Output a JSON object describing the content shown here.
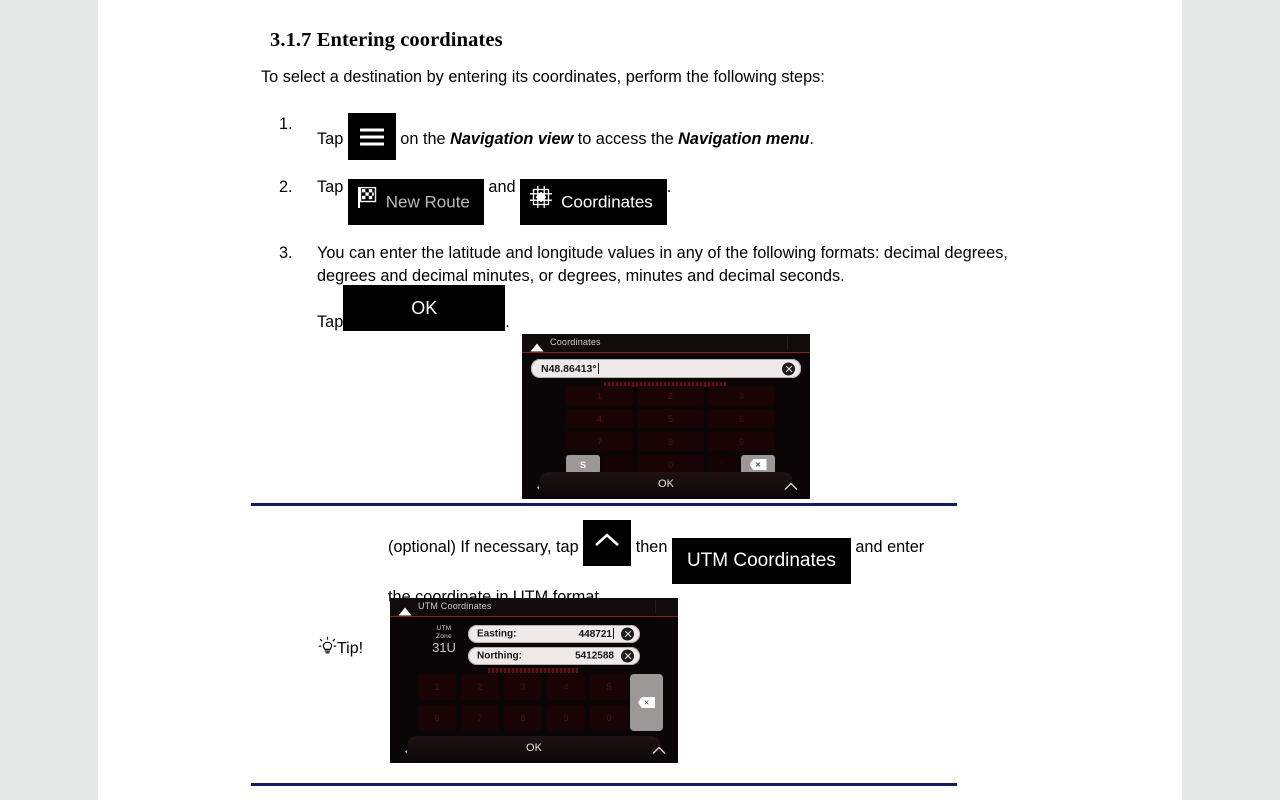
{
  "document": {
    "section_number": "3.1.7",
    "section_title": "3.1.7 Entering coordinates",
    "intro": "To select a destination by entering its coordinates, perform the following steps:"
  },
  "steps": [
    {
      "number": "1.",
      "text_before": "Tap",
      "chip": {
        "icon": "hamburger-icon",
        "label": ""
      },
      "text_mid": " on the ",
      "emphasis_1": "Navigation view",
      "text_mid_2": " to access the ",
      "emphasis_2": "Navigation menu",
      "text_after": "."
    },
    {
      "number": "2.",
      "text_before": "Tap",
      "chip_1": {
        "icon": "checkered-flag-icon",
        "label": "New Route"
      },
      "text_mid": "and",
      "chip_2": {
        "icon": "coordinates-grid-icon",
        "label": "Coordinates"
      },
      "text_after": "."
    },
    {
      "number": "3.",
      "text": "You can enter the latitude and longitude values in any of the following formats: decimal degrees, degrees and decimal minutes, or degrees, minutes and decimal seconds.",
      "tap_label": "Tap",
      "chip": {
        "label": "OK"
      },
      "text_after": "."
    }
  ],
  "screens": {
    "coordinates": {
      "title": "Coordinates",
      "header_icon": "up-triangle-icon",
      "input_value": "N48.86413°",
      "clear_icon": "clear-circle-icon",
      "keypad_rows": [
        [
          "1",
          "2",
          "3"
        ],
        [
          "4",
          "5",
          "6"
        ],
        [
          "7",
          "8",
          "9"
        ]
      ],
      "bottom_keys": [
        "S",
        "'",
        "0",
        "\""
      ],
      "backspace_icon": "backspace-icon",
      "footer": {
        "back_icon": "arrow-left-icon",
        "ok_label": "OK",
        "expand_icon": "chevron-up-icon"
      }
    },
    "utm_coordinates": {
      "title": "UTM Coordinates",
      "header_icon": "up-triangle-icon",
      "zone_label_line1": "UTM",
      "zone_label_line2": "Zone",
      "zone_value": "31U",
      "fields": [
        {
          "label": "Easting:",
          "value": "448721"
        },
        {
          "label": "Northing:",
          "value": "5412588"
        }
      ],
      "clear_icon": "clear-circle-icon",
      "keypad_rows": [
        [
          "1",
          "2",
          "3",
          "4",
          "5"
        ],
        [
          "6",
          "7",
          "8",
          "9",
          "0"
        ]
      ],
      "backspace_icon": "backspace-icon",
      "footer": {
        "back_icon": "arrow-left-icon",
        "ok_label": "OK",
        "expand_icon": "chevron-up-icon"
      }
    }
  },
  "optional_note": {
    "text_before": "(optional) If necessary, tap",
    "chip_1": {
      "icon": "chevron-up-icon",
      "label": ""
    },
    "text_mid": "then",
    "chip_2": {
      "label": "UTM Coordinates"
    },
    "text_after": "and enter",
    "text_line2": "the coordinate in UTM format."
  },
  "tip": {
    "icon": "lightbulb-icon",
    "label": "Tip!"
  },
  "colors": {
    "page_background": "#e4e8e7",
    "page": "#ffffff",
    "divider": "#141a5e",
    "chip_background": "#000000",
    "device_accent": "#8d2218"
  }
}
